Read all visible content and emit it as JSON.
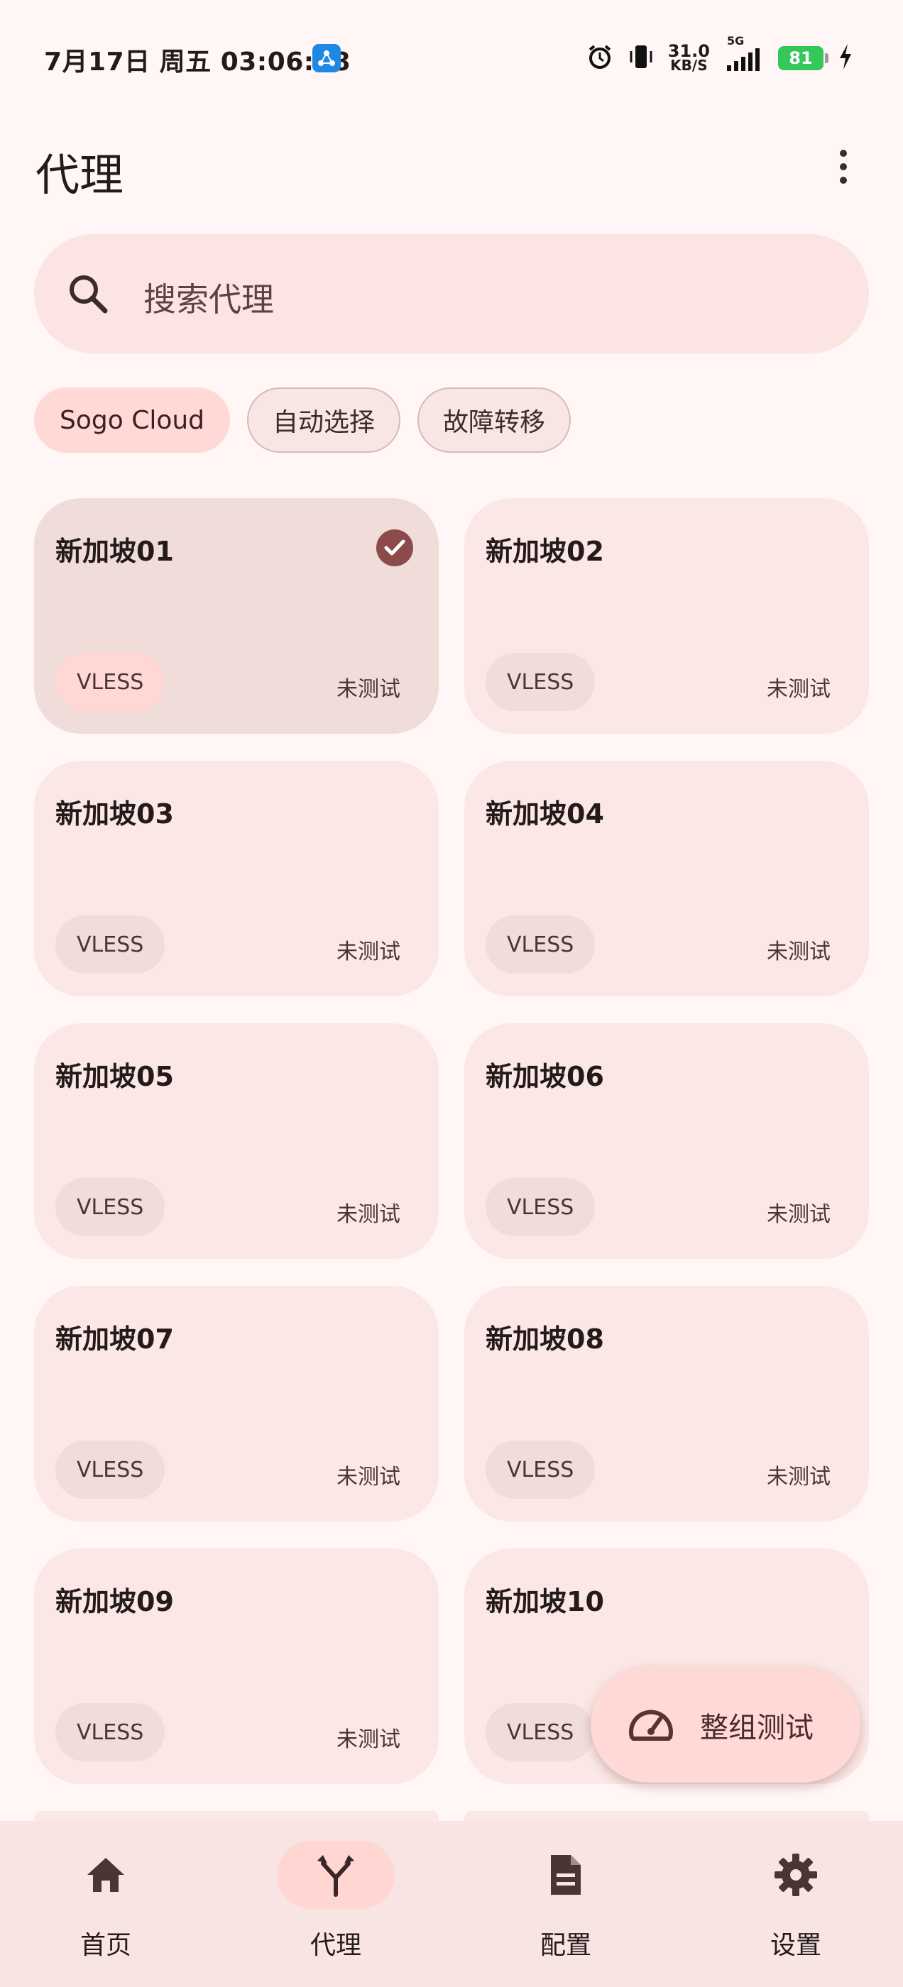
{
  "status_bar": {
    "time": "7月17日 周五 03:06:18",
    "net_speed": "31.0",
    "net_unit": "KB/S",
    "network": "5G",
    "battery": "81"
  },
  "header": {
    "title": "代理"
  },
  "search": {
    "placeholder": "搜索代理"
  },
  "groups": [
    {
      "label": "Sogo Cloud",
      "active": true
    },
    {
      "label": "自动选择",
      "active": false
    },
    {
      "label": "故障转移",
      "active": false
    }
  ],
  "proxies": [
    {
      "name": "新加坡01",
      "type": "VLESS",
      "status": "未测试",
      "selected": true
    },
    {
      "name": "新加坡02",
      "type": "VLESS",
      "status": "未测试"
    },
    {
      "name": "新加坡03",
      "type": "VLESS",
      "status": "未测试"
    },
    {
      "name": "新加坡04",
      "type": "VLESS",
      "status": "未测试"
    },
    {
      "name": "新加坡05",
      "type": "VLESS",
      "status": "未测试"
    },
    {
      "name": "新加坡06",
      "type": "VLESS",
      "status": "未测试"
    },
    {
      "name": "新加坡07",
      "type": "VLESS",
      "status": "未测试"
    },
    {
      "name": "新加坡08",
      "type": "VLESS",
      "status": "未测试"
    },
    {
      "name": "新加坡09",
      "type": "VLESS",
      "status": "未测试"
    },
    {
      "name": "新加坡10",
      "type": "VLESS",
      "status": ""
    }
  ],
  "fab": {
    "label": "整组测试",
    "icon": "speedometer-icon"
  },
  "nav": [
    {
      "label": "首页",
      "icon": "home-icon"
    },
    {
      "label": "代理",
      "icon": "proxy-fork-icon",
      "active": true
    },
    {
      "label": "配置",
      "icon": "document-icon"
    },
    {
      "label": "设置",
      "icon": "gear-icon"
    }
  ],
  "colors": {
    "background": "#fff6f5",
    "card": "#fbe7e5",
    "accent": "#ffd9d6",
    "check": "#8c4a4a"
  }
}
